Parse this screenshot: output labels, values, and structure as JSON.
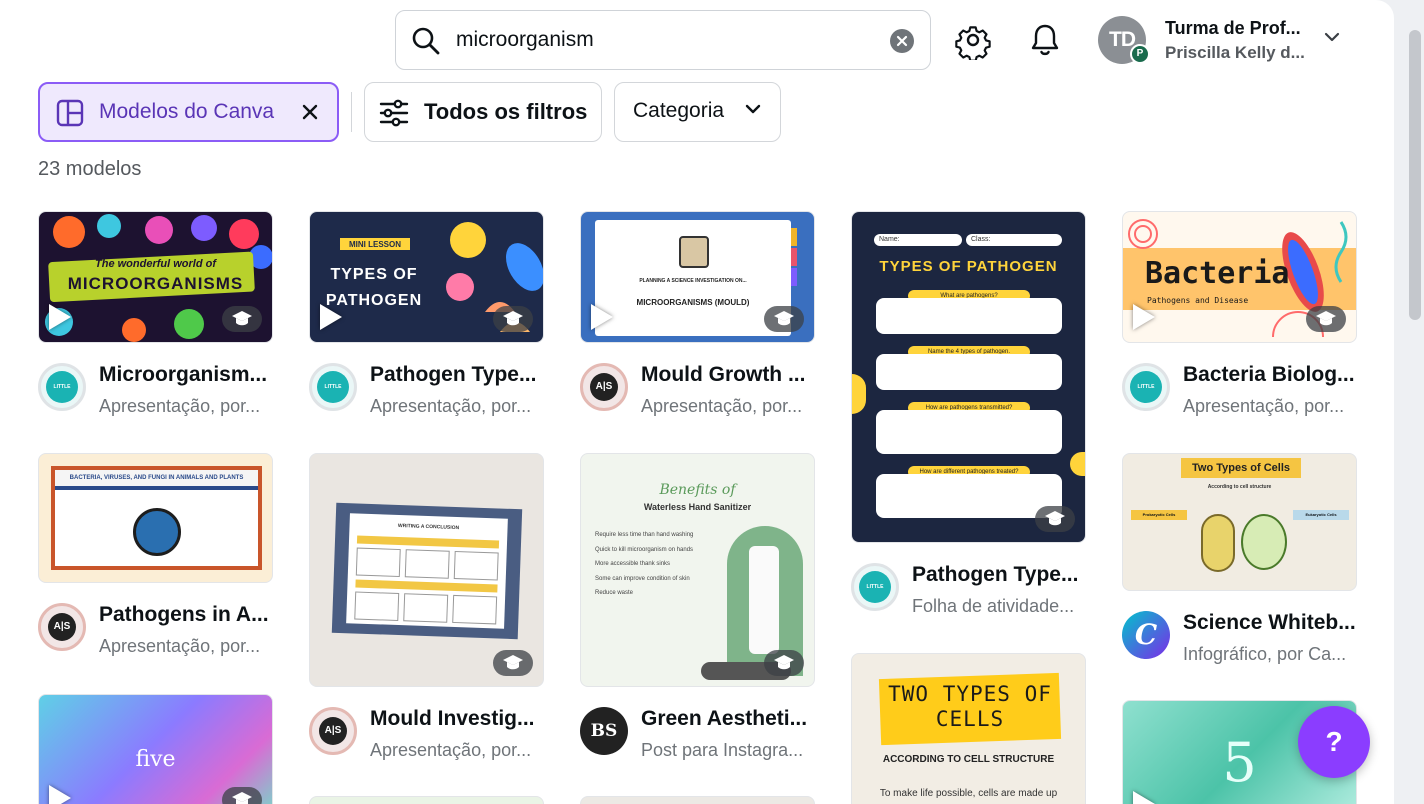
{
  "search": {
    "value": "microorganism"
  },
  "account": {
    "initials": "TD",
    "badge": "P",
    "name": "Turma de Prof...",
    "subtitle": "Priscilla Kelly d..."
  },
  "filters": {
    "modelos_label": "Modelos do Canva",
    "todos_label": "Todos os filtros",
    "categoria_label": "Categoria"
  },
  "results_count": "23 modelos",
  "cards": [
    {
      "title": "Microorganism...",
      "subtitle": "Apresentação, por...",
      "creator": "LITTLE SCIENCE SHOP",
      "thumb_line1": "The wonderful world of",
      "thumb_line2": "MICROORGANISMS"
    },
    {
      "title": "Pathogen Type...",
      "subtitle": "Apresentação, por...",
      "creator": "LITTLE SCIENCE SHOP",
      "thumb_line1": "MINI LESSON",
      "thumb_line2": "TYPES OF PATHOGEN"
    },
    {
      "title": "Mould Growth ...",
      "subtitle": "Apresentação, por...",
      "creator": "A|S",
      "thumb_line1": "PLANNING A SCIENCE INVESTIGATION ON...",
      "thumb_line2": "MICROORGANISMS (MOULD)"
    },
    {
      "title": "Pathogen Type...",
      "subtitle": "Folha de atividade...",
      "creator": "LITTLE SCIENCE SHOP",
      "thumb_line1": "TYPES OF PATHOGEN",
      "thumb_q1": "What are pathogens?",
      "thumb_q2": "Name the 4 types of pathogen.",
      "thumb_q3": "How are pathogens transmitted?",
      "thumb_q4": "How are different pathogens treated?",
      "thumb_name": "Name:",
      "thumb_class": "Class:"
    },
    {
      "title": "Bacteria Biolog...",
      "subtitle": "Apresentação, por...",
      "creator": "LITTLE SCIENCE SHOP",
      "thumb_line1": "Bacteria",
      "thumb_line2": "Pathogens and Disease"
    },
    {
      "title": "Pathogens in A...",
      "subtitle": "Apresentação, por...",
      "creator": "A|S",
      "thumb_line1": "BACTERIA, VIRUSES, AND FUNGI IN ANIMALS AND PLANTS"
    },
    {
      "title": "Mould Investig...",
      "subtitle": "Apresentação, por...",
      "creator": "A|S",
      "thumb_line1": "WRITING A CONCLUSION"
    },
    {
      "title": "Green Aestheti...",
      "subtitle": "Post para Instagra...",
      "creator": "BS",
      "thumb_line1": "Benefits of",
      "thumb_line2": "Waterless Hand Sanitizer",
      "thumb_bullets": [
        "Require less time than hand washing",
        "Quick to kill microorganism on hands",
        "More accessible thank sinks",
        "Some can improve condition of skin",
        "Reduce waste"
      ]
    },
    {
      "title": "Science Whiteb...",
      "subtitle": "Infográfico, por Ca...",
      "creator": "C",
      "thumb_line1": "Two Types of Cells",
      "thumb_line2": "According to cell structure",
      "thumb_left": "Prokaryotic Cells",
      "thumb_right": "Eukaryotic Cells"
    },
    {
      "thumb_line1": "five"
    },
    {
      "thumb_line1": "TWO TYPES OF CELLS",
      "thumb_line2": "ACCORDING TO CELL STRUCTURE",
      "thumb_line3": "To make life possible, cells are made up"
    },
    {
      "thumb_line1": "5"
    }
  ],
  "help": {
    "label": "?"
  },
  "colors": {
    "accent": "#8b3dff",
    "chip_active_bg": "#efe9fd",
    "chip_active_border": "#8b5cf6"
  }
}
